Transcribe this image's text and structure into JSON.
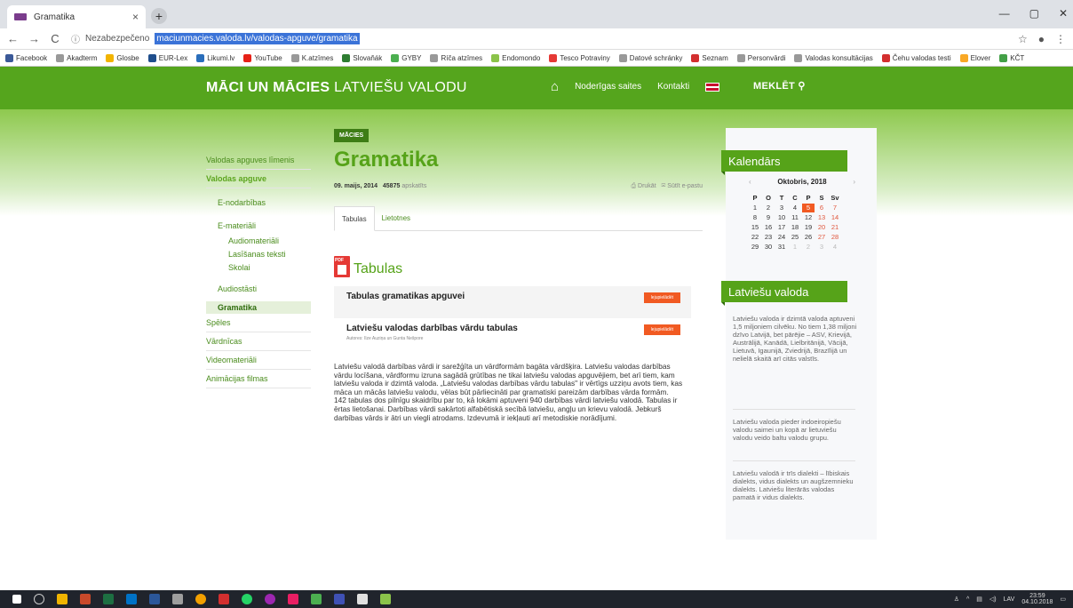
{
  "browser": {
    "tab_title": "Gramatika",
    "tab_close": "×",
    "new_tab": "+",
    "win_controls": [
      "—",
      "▢",
      "✕"
    ],
    "nav": {
      "back": "←",
      "forward": "→",
      "reload": "C"
    },
    "insecure_label": "Nezabezpečeno",
    "info_icon": "ⓘ",
    "url": "maciunmacies.valoda.lv/valodas-apguve/gramatika",
    "star": "☆",
    "account": "●",
    "menu": "⋮",
    "bookmarks": [
      {
        "label": "Facebook",
        "color": "#3b5998"
      },
      {
        "label": "Akadterm",
        "color": "#999999"
      },
      {
        "label": "Glosbe",
        "color": "#f2b400"
      },
      {
        "label": "EUR-Lex",
        "color": "#1f4e8c"
      },
      {
        "label": "Likumi.lv",
        "color": "#2a6ebb"
      },
      {
        "label": "YouTube",
        "color": "#e62117"
      },
      {
        "label": "K.atzīmes",
        "color": "#999999"
      },
      {
        "label": "Slovaňák",
        "color": "#2e7d32"
      },
      {
        "label": "GYBY",
        "color": "#4caf50"
      },
      {
        "label": "Ríča atzīmes",
        "color": "#999999"
      },
      {
        "label": "Endomondo",
        "color": "#8bc34a"
      },
      {
        "label": "Tesco Potraviny",
        "color": "#e53935"
      },
      {
        "label": "Datové schránky",
        "color": "#999999"
      },
      {
        "label": "Seznam",
        "color": "#d32f2f"
      },
      {
        "label": "Personvārdi",
        "color": "#999999"
      },
      {
        "label": "Valodas konsultācijas",
        "color": "#999999"
      },
      {
        "label": "Čehu valodas testi",
        "color": "#d32f2f"
      },
      {
        "label": "Elover",
        "color": "#f9a825"
      },
      {
        "label": "KČT",
        "color": "#43a047"
      }
    ]
  },
  "site": {
    "logo_bold": "MĀCI UN MĀCIES",
    "logo_light": "LATVIEŠU VALODU",
    "nav": [
      "Noderīgas saites",
      "Kontakti"
    ],
    "home_icon": "⌂",
    "search_label": "MEKLĒT",
    "search_icon": "⚲"
  },
  "left_nav": {
    "items": [
      {
        "label": "Valodas apguves līmenis"
      },
      {
        "label": "Valodas apguve"
      },
      {
        "label": "E-nodarbības"
      },
      {
        "label": "E-materiāli"
      },
      {
        "label": "Audiomateriāli"
      },
      {
        "label": "Lasīšanas teksti"
      },
      {
        "label": "Skolai"
      },
      {
        "label": "Audiostāsti"
      },
      {
        "label": "Gramatika"
      },
      {
        "label": "Spēles"
      },
      {
        "label": "Vārdnīcas"
      },
      {
        "label": "Videomateriāli"
      },
      {
        "label": "Animācijas filmas"
      }
    ]
  },
  "article": {
    "badge": "MĀCIES",
    "title": "Gramatika",
    "date": "09. maijs, 2014",
    "views": "45875",
    "views_label": "apskatīts",
    "print": "Drukāt",
    "email": "Sūtīt e-pastu",
    "tabs": [
      "Tabulas",
      "Lietotnes"
    ],
    "section_title": "Tabulas",
    "rows": [
      {
        "title": "Tabulas gramatikas apguvei",
        "authors": "",
        "button": "lejupielādēt"
      },
      {
        "title": "Latviešu valodas darbības vārdu tabulas",
        "authors": "Autores: Ilze Auziņa un Gunta Nešpore",
        "button": "lejupielādēt"
      }
    ],
    "paragraph_1": "Latviešu valodā darbības vārdi ir sarežģīta un vārdformām bagāta vārdšķira. Latviešu valodas darbības vārdu locīšana, vārdformu izruna sagādā grūtības ne tikai latviešu valodas apguvējiem, bet arī tiem, kam latviešu valoda ir dzimtā valoda. „Latviešu valodas darbības vārdu tabulas\" ir vērtīgs uzziņu avots tiem, kas māca un mācās latviešu valodu, vēlas būt pārliecināti par gramatiski pareizām darbības vārda formām.",
    "paragraph_2": "142 tabulas dos pilnīgu skaidrību par to, kā lokāmi aptuveni 940 darbības vārdi latviešu valodā. Tabulas ir ērtas lietošanai. Darbības vārdi sakārtoti alfabētiskā secībā latviešu, angļu un krievu valodā. Jebkurš darbības vārds ir ātri un viegli atrodams. Izdevumā ir iekļauti arī metodiskie norādījumi."
  },
  "sidebar": {
    "calendar_title": "Kalendārs",
    "month": "Oktobris, 2018",
    "prev": "‹",
    "next": "›",
    "weekdays": [
      "P",
      "O",
      "T",
      "C",
      "P",
      "S",
      "Sv"
    ],
    "days": [
      [
        "1",
        "2",
        "3",
        "4",
        "5",
        "6",
        "7"
      ],
      [
        "8",
        "9",
        "10",
        "11",
        "12",
        "13",
        "14"
      ],
      [
        "15",
        "16",
        "17",
        "18",
        "19",
        "20",
        "21"
      ],
      [
        "22",
        "23",
        "24",
        "25",
        "26",
        "27",
        "28"
      ],
      [
        "29",
        "30",
        "31",
        "1",
        "2",
        "3",
        "4"
      ]
    ],
    "today": "5",
    "language_title": "Latviešu valoda",
    "texts": [
      "Latviešu valoda ir dzimtā valoda aptuveni 1,5 miljoniem cilvēku. No tiem 1,38 miljoni dzīvo Latvijā, bet pārējie – ASV, Krievijā, Austrālijā, Kanādā, Lielbritānijā, Vācijā, Lietuvā, Igaunijā, Zviedrijā, Brazīlijā un nelielā skaitā arī citās valstīs.",
      "Latviešu valoda pieder indoeiropiešu valodu saimei un kopā ar lietuviešu valodu veido baltu valodu grupu.",
      "Latviešu valodā ir trīs dialekti – lībiskais dialekts, vidus dialekts un augšzemnieku dialekts. Latviešu literārās valodas pamatā ir vidus dialekts."
    ]
  },
  "taskbar": {
    "lang": "LAV",
    "time": "23:59",
    "date": "04.10.2018"
  }
}
